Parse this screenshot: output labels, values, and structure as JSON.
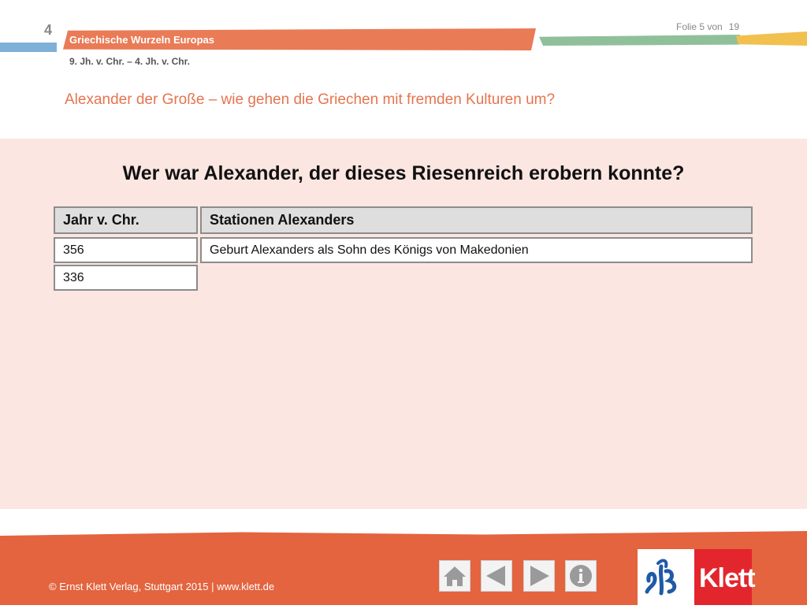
{
  "header": {
    "chapter_number": "4",
    "slide_label": "Folie 5 von",
    "slide_total": "19",
    "series_title": "Griechische Wurzeln Europas",
    "period": "9. Jh. v. Chr. – 4. Jh. v. Chr.",
    "page_title": "Alexander der Große – wie gehen die Griechen mit fremden Kulturen um?"
  },
  "main": {
    "question": "Wer war Alexander, der dieses Riesenreich erobern konnte?",
    "table": {
      "headers": [
        "Jahr v. Chr.",
        "Stationen Alexanders"
      ],
      "rows": [
        {
          "year": "356",
          "station": "Geburt Alexanders als Sohn des Königs von Makedonien"
        },
        {
          "year": "336",
          "station": ""
        }
      ]
    }
  },
  "footer": {
    "copyright": "© Ernst Klett Verlag, Stuttgart 2015 | www.klett.de",
    "nav": [
      "home-icon",
      "previous-icon",
      "next-icon",
      "info-icon"
    ],
    "logo_text": "Klett"
  },
  "colors": {
    "accent_orange": "#e97b56",
    "title_orange": "#e6744f",
    "panel_pink": "#fbe6e1",
    "footer_orange": "#e3643f",
    "klett_red": "#e3252d"
  }
}
